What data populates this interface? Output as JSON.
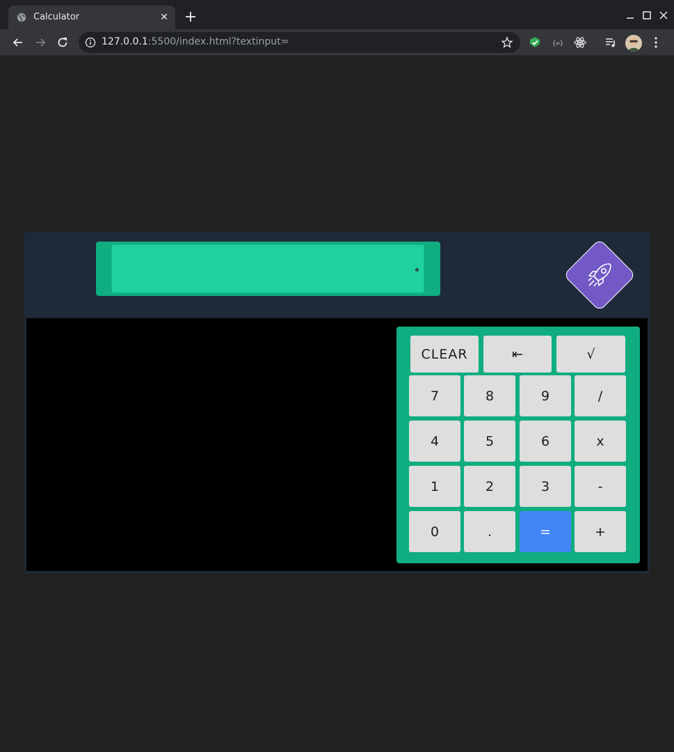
{
  "browser": {
    "tab_title": "Calculator",
    "tab_favicon": "globe-icon",
    "close_tab_label": "✕",
    "new_tab_label": "+",
    "url_host": "127.0.0.1",
    "url_rest": ":5500/index.html?textinput=",
    "extensions": [
      "grammar-check-icon",
      "code-braces-icon",
      "react-devtools-icon",
      "media-playlist-icon"
    ]
  },
  "calculator": {
    "display": {
      "value": "",
      "placeholder": ""
    },
    "logo_icon": "rocket-icon",
    "keys": {
      "clear": "CLEAR",
      "backspace": "⇤",
      "sqrt": "√",
      "seven": "7",
      "eight": "8",
      "nine": "9",
      "divide": "/",
      "four": "4",
      "five": "5",
      "six": "6",
      "multiply": "x",
      "one": "1",
      "two": "2",
      "three": "3",
      "minus": "-",
      "zero": "0",
      "dot": ".",
      "equals": "=",
      "plus": "+"
    },
    "colors": {
      "panel": "#1e2a3a",
      "display_frame": "#10ad80",
      "display": "#20d1a0",
      "key": "#dedede",
      "equals": "#4285f4",
      "logo": "#7359c6"
    }
  }
}
